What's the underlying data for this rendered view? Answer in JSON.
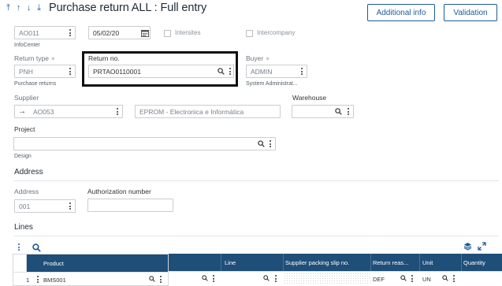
{
  "header": {
    "nav_icons": [
      "first-record-icon",
      "previous-record-icon",
      "next-record-icon",
      "last-record-icon"
    ],
    "title": "Purchase return ALL : Full entry",
    "additional_info_label": "Additional info",
    "validation_label": "Validation"
  },
  "top": {
    "site_value": "AO011",
    "site_sub": "InfoCenter",
    "date_value": "05/02/20",
    "intersites_label": "Intersites",
    "intercompany_label": "Intercompany"
  },
  "return_type": {
    "label": "Return type",
    "value": "PNH",
    "sub": "Purchase returns"
  },
  "return_no": {
    "label": "Return no.",
    "value": "PRTAO0110001"
  },
  "buyer": {
    "label": "Buyer",
    "value": "ADMIN",
    "sub": "System Administrat..."
  },
  "supplier": {
    "label": "Supplier",
    "arrow": "→",
    "value": "AO053",
    "name": "EPROM - Electronica e Informática"
  },
  "warehouse": {
    "label": "Warehouse",
    "value": ""
  },
  "project": {
    "label": "Project",
    "value": "",
    "sub": "Design"
  },
  "address_section": {
    "title": "Address"
  },
  "address": {
    "label": "Address",
    "value": "001"
  },
  "authorization": {
    "label": "Authorization number",
    "value": ""
  },
  "lines": {
    "title": "Lines",
    "columns_left": [
      "Product"
    ],
    "columns_right": [
      "Line",
      "Supplier packing slip no.",
      "Return reas...",
      "Unit",
      "Quantity"
    ],
    "rows": [
      {
        "num": "1",
        "product": "BMS001",
        "line": "",
        "slip": "",
        "reason": "DEF",
        "unit": "UN",
        "quantity": ""
      }
    ]
  },
  "colors": {
    "accent": "#1e5b9a",
    "table_header": "#1f4e79"
  }
}
